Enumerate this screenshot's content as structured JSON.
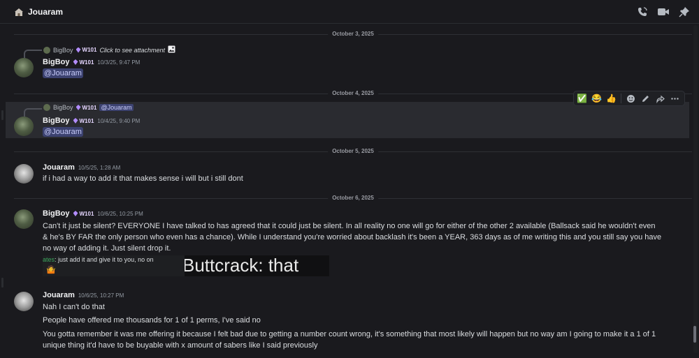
{
  "header": {
    "channel_name": "Jouaram",
    "channel_icon": "house-avatar-icon",
    "actions": [
      "voice-call-icon",
      "video-call-icon",
      "pin-icon"
    ]
  },
  "dividers": [
    "October 3, 2025",
    "October 4, 2025",
    "October 5, 2025",
    "October 6, 2025"
  ],
  "messages": {
    "m1": {
      "reply": {
        "author": "BigBoy",
        "tag": "W101",
        "text": "Click to see attachment",
        "icon": "image-icon"
      },
      "author": "BigBoy",
      "tag": "W101",
      "timestamp": "10/3/25, 9:47 PM",
      "mention": "@Jouaram"
    },
    "m2": {
      "reply": {
        "author": "BigBoy",
        "tag": "W101",
        "mention": "@Jouaram"
      },
      "author": "BigBoy",
      "tag": "W101",
      "timestamp": "10/4/25, 9:40 PM",
      "mention": "@Jouaram"
    },
    "m3": {
      "author": "Jouaram",
      "timestamp": "10/5/25, 1:28 AM",
      "text": "if i had a way to add it that makes sense i will but i still dont"
    },
    "m4": {
      "author": "BigBoy",
      "tag": "W101",
      "timestamp": "10/6/25, 10:25 PM",
      "line1": "Can't it just be silent?  EVERYONE I have talked to has agreed that it could just be silent. In all reality no one will go for either of the other 2 available (Ballsack said he wouldn't even",
      "line2": "& he's BY FAR the only person who even has a chance). While I understand you're worried about backlash it's been a YEAR, 363 days as of me writing this and you still say you have",
      "line3": "no way of adding it. Just silent drop it.",
      "embed": {
        "left_name": "ates",
        "left_text": ": just add it and give it to you, no on",
        "left_emoji": "🤷",
        "right_text": "Buttcrack: that"
      }
    },
    "m5": {
      "author": "Jouaram",
      "timestamp": "10/6/25, 10:27 PM",
      "text1": "Nah I can't do that",
      "text2": "People have offered me thousands for 1 of 1 perms, I've said no",
      "text3a": "You gotta remember it was me offering it because I felt bad due to getting a number count wrong, it's something that most likely will happen but no way am I going to make it a 1 of 1",
      "text3b": "unique thing it'd have to be buyable with x amount of sabers like I said previously"
    }
  },
  "hover_toolbar": {
    "reactions": [
      "✅",
      "😂",
      "👍"
    ],
    "actions": [
      "add-reaction-icon",
      "edit-icon",
      "forward-icon",
      "more-icon"
    ]
  },
  "colors": {
    "background": "#1a1a1e",
    "mention_bg": "#3c4270",
    "role_tag": "#b28cff",
    "highlight": "#2a2b30"
  }
}
